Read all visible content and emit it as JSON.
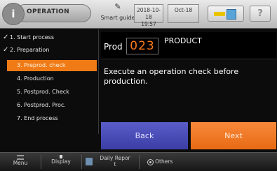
{
  "header": {
    "mode": "OPERATION",
    "guide": {
      "label": "Smart guide",
      "icon": "pen-tool-icon"
    },
    "date": {
      "line1": "2018-10-18",
      "line2": "19:57"
    },
    "month": {
      "line1": "Oct-18"
    },
    "status_icons": [
      "pencil-icon",
      "tablet-icon"
    ],
    "help": "?"
  },
  "steps": [
    {
      "label": "1. Start process",
      "done": true
    },
    {
      "label": "2. Preparation",
      "done": true
    },
    {
      "label": "3. Preprod. check",
      "active": true
    },
    {
      "label": "4. Production"
    },
    {
      "label": "5. Postprod. Check"
    },
    {
      "label": "6. Postprod. Proc."
    },
    {
      "label": "7. End process"
    }
  ],
  "check_mark": "✓",
  "product": {
    "label": "Prod",
    "number": "023",
    "title": "PRODUCT"
  },
  "message": "Execute an operation check before production.",
  "buttons": {
    "back": "Back",
    "next": "Next"
  },
  "nav": [
    {
      "label": "Menu"
    },
    {
      "label": "Display"
    },
    {
      "label": "Daily Repor",
      "sub": "t"
    },
    {
      "label": "Others"
    }
  ],
  "colors": {
    "accent_orange": "#f07b16",
    "back_blue": "#4a4cb8",
    "prod_number": "#ff7a1a"
  }
}
